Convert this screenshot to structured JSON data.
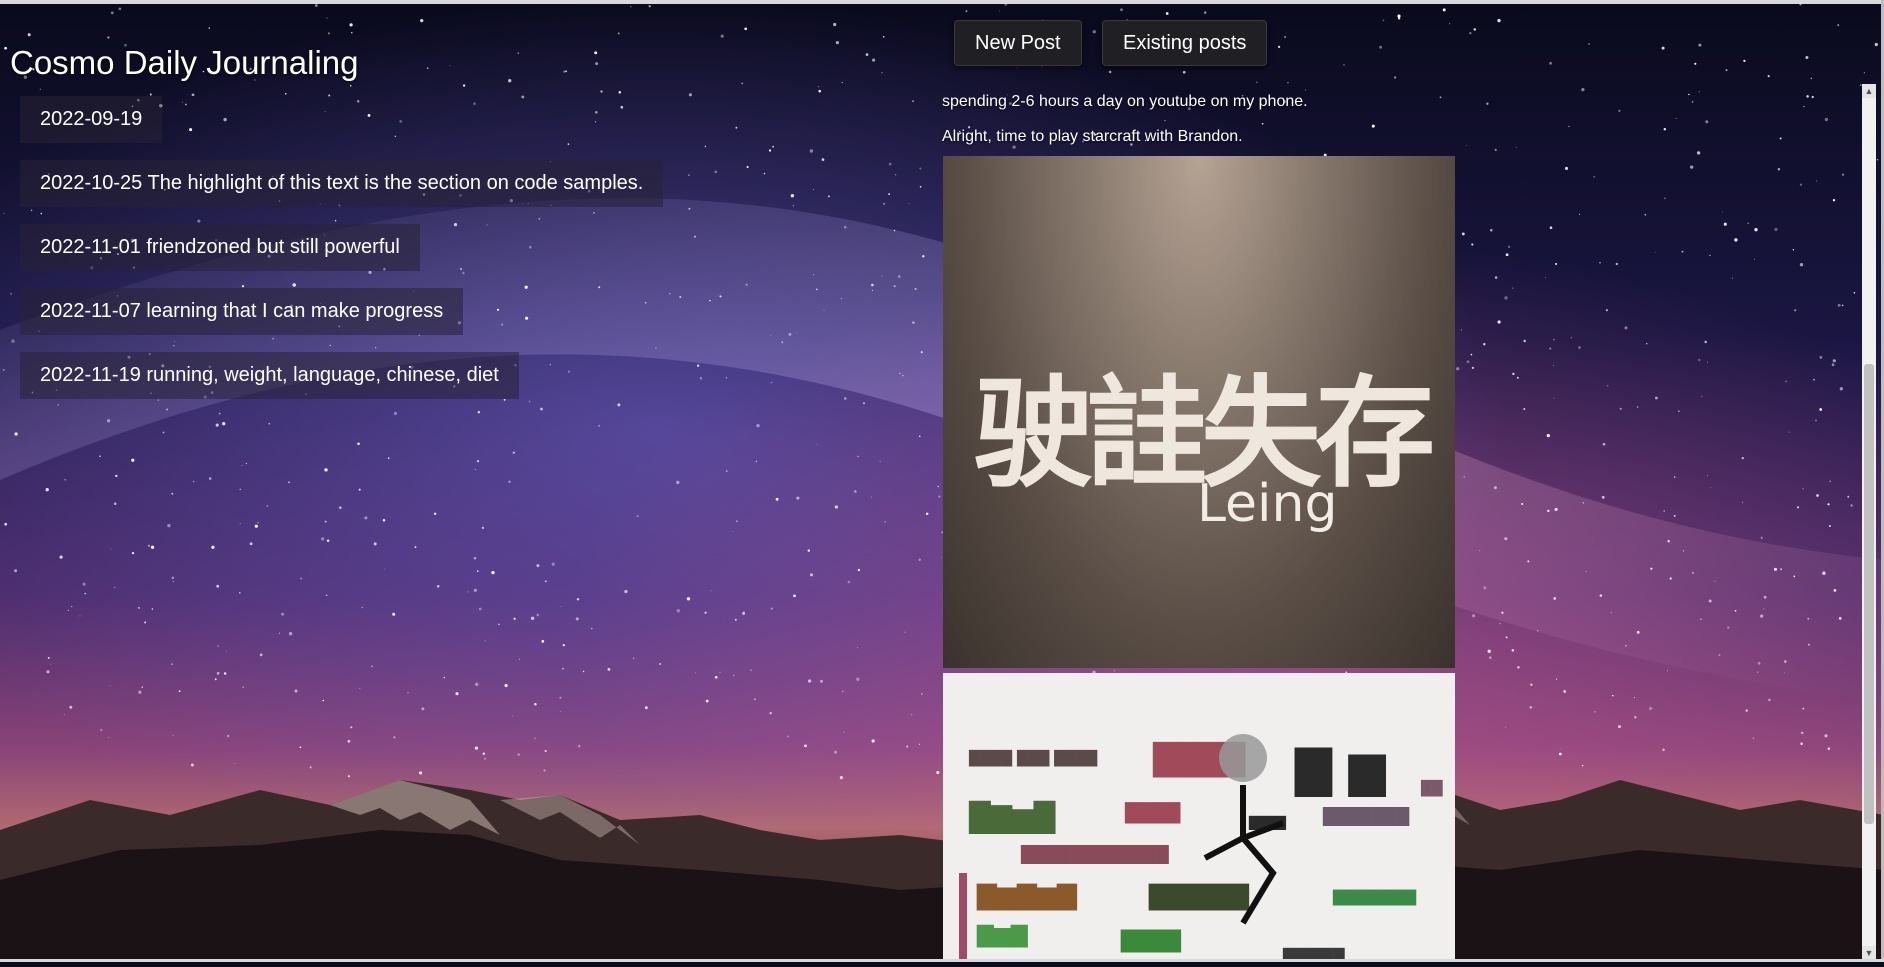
{
  "app": {
    "title": "Cosmo Daily Journaling"
  },
  "nav": {
    "new_post": "New Post",
    "existing_posts": "Existing posts"
  },
  "posts": [
    {
      "label": "2022-09-19"
    },
    {
      "label": "2022-10-25 The highlight of this text is the section on code samples."
    },
    {
      "label": "2022-11-01 friendzoned but still powerful"
    },
    {
      "label": "2022-11-07 learning that I can make progress"
    },
    {
      "label": "2022-11-19 running, weight, language, chinese, diet"
    }
  ],
  "content": {
    "paragraphs": [
      "spending 2-6 hours a day on youtube on my phone.",
      "Alright, time to play starcraft with Brandon."
    ],
    "image1": {
      "glyphs": "驶詿失存",
      "caption": "Leing"
    }
  },
  "colors": {
    "panel": "#1f1f24",
    "text": "#ffffff",
    "sky_top": "#0b0b1e",
    "sky_glow": "#c65f92"
  }
}
